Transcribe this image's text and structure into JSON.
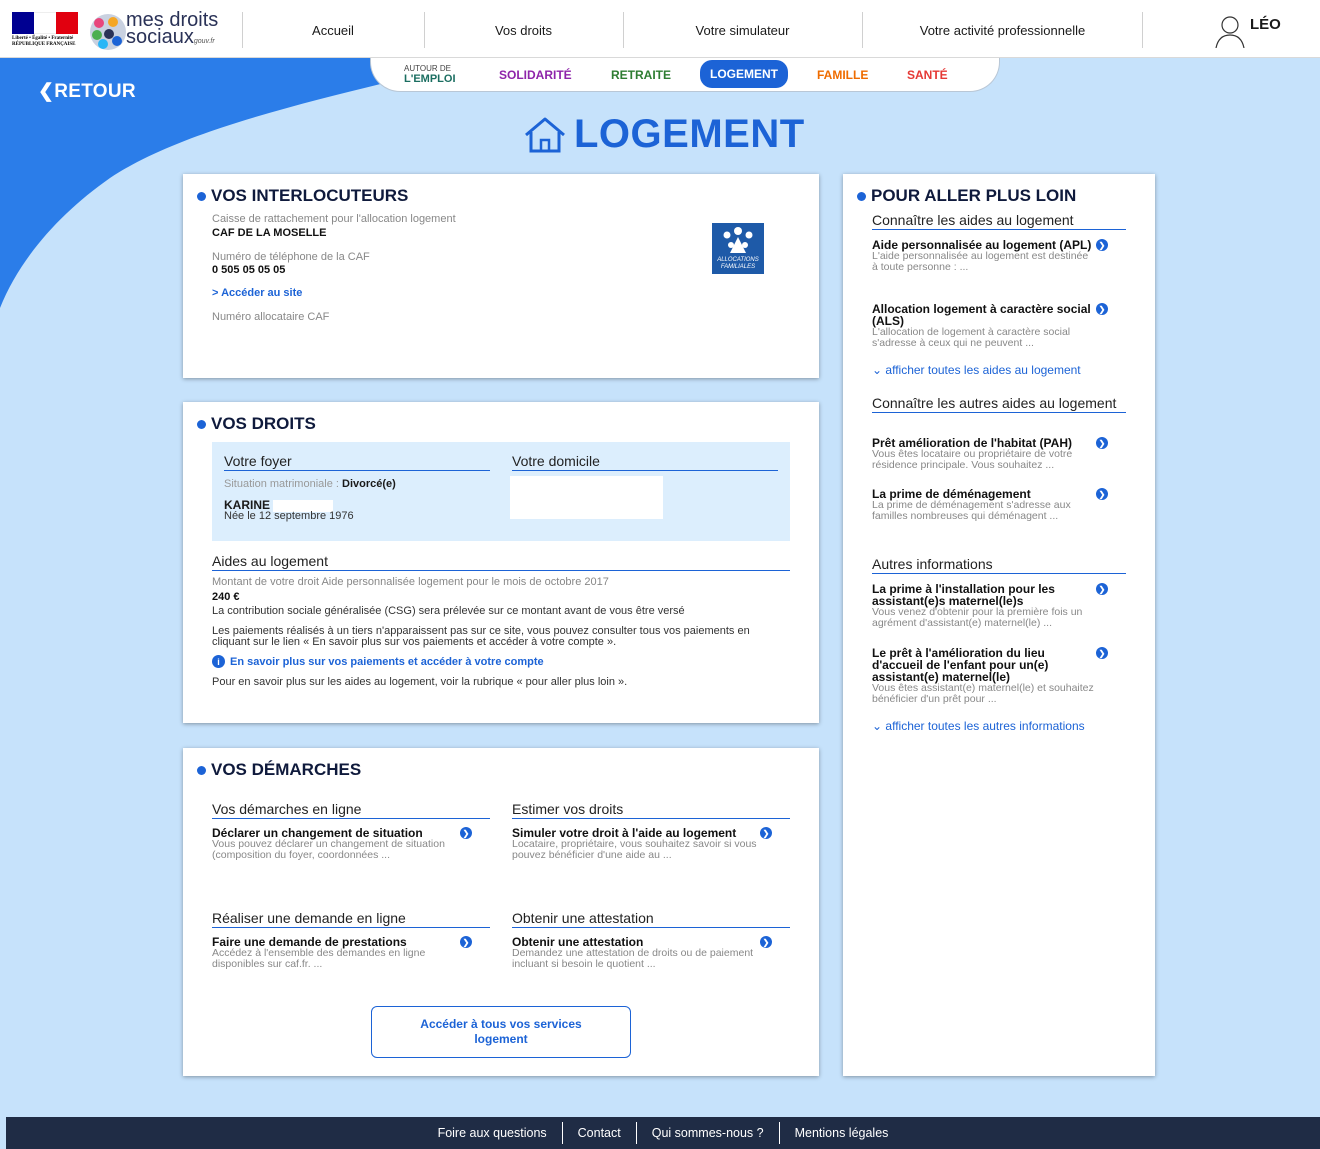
{
  "header": {
    "rf_text": "Liberté • Égalité • Fraternité\nRÉPUBLIQUE FRANÇAISE",
    "logo_line1": "mes droits",
    "logo_line2": "sociaux",
    "logo_domain": "gouv.fr",
    "nav": [
      "Accueil",
      "Vos droits",
      "Votre simulateur",
      "Votre activité professionnelle"
    ],
    "user_name": "LÉO"
  },
  "back_label": "RETOUR",
  "tabs": {
    "emploi_small": "AUTOUR DE",
    "emploi": "L'EMPLOI",
    "solidarite": "SOLIDARITÉ",
    "retraite": "RETRAITE",
    "logement": "LOGEMENT",
    "famille": "FAMILLE",
    "sante": "SANTÉ"
  },
  "colors": {
    "accent": "#1c63d6",
    "solidarite": "#8e24aa",
    "retraite": "#2e7d32",
    "famille": "#ef6c00",
    "sante": "#e53935",
    "emploi": "#1b6e61"
  },
  "page_title": "LOGEMENT",
  "interlocuteurs": {
    "title": "VOS INTERLOCUTEURS",
    "caisse_label": "Caisse de rattachement pour l'allocation logement",
    "caisse_value": "CAF DE LA MOSELLE",
    "phone_label": "Numéro de téléphone de la CAF",
    "phone_value": "0 505 05 05 05",
    "site_link": "> Accéder au site",
    "allocataire_label": "Numéro allocataire CAF",
    "caf_logo_text": "ALLOCATIONS FAMILIALES"
  },
  "droits": {
    "title": "VOS DROITS",
    "foyer_head": "Votre foyer",
    "domicile_head": "Votre domicile",
    "situation_label": "Situation matrimoniale :",
    "situation_value": "Divorcé(e)",
    "person_name": "KARINE",
    "person_birth": "Née le 12 septembre 1976",
    "aides_head": "Aides au logement",
    "montant_label": "Montant de votre droit Aide personnalisée logement pour le mois de octobre 2017",
    "montant_value": "240 €",
    "csg_text": "La contribution sociale généralisée (CSG) sera prélevée sur ce montant avant de vous être versé",
    "paiements_text": "Les paiements réalisés à un tiers n'apparaissent pas sur ce site, vous pouvez consulter tous vos paiements en cliquant sur le lien « En savoir plus sur vos paiements et accéder à votre compte ».",
    "paiements_link": "En savoir plus sur vos paiements et accéder à votre compte",
    "plus_loin_text": "Pour en savoir plus sur les aides au logement, voir la rubrique « pour aller plus loin »."
  },
  "demarches": {
    "title": "VOS DÉMARCHES",
    "sections": [
      {
        "head": "Vos démarches en ligne",
        "item_title": "Déclarer un changement de situation",
        "item_desc": "Vous pouvez déclarer un changement de situation (composition du foyer, coordonnées ..."
      },
      {
        "head": "Estimer vos droits",
        "item_title": "Simuler votre droit à l'aide au logement",
        "item_desc": "Locataire, propriétaire, vous souhaitez savoir si vous pouvez bénéficier d'une aide au ..."
      },
      {
        "head": "Réaliser une demande en ligne",
        "item_title": "Faire une demande de prestations",
        "item_desc": "Accédez à l'ensemble des demandes en ligne disponibles sur caf.fr. ..."
      },
      {
        "head": "Obtenir une attestation",
        "item_title": "Obtenir une attestation",
        "item_desc": "Demandez une attestation de droits ou de paiement incluant si besoin le quotient ..."
      }
    ],
    "services_button": "Accéder à tous vos services logement"
  },
  "plus_loin": {
    "title": "POUR ALLER PLUS LOIN",
    "sections": [
      {
        "head": "Connaître les aides au logement",
        "items": [
          {
            "title": "Aide personnalisée au logement (APL)",
            "desc": "L'aide personnalisée au logement est destinée à toute personne : ..."
          },
          {
            "title": "Allocation logement à caractère social (ALS)",
            "desc": "L'allocation de logement à caractère social s'adresse à ceux qui ne peuvent ..."
          }
        ],
        "more": "afficher toutes les aides au logement"
      },
      {
        "head": "Connaître les autres aides au logement",
        "items": [
          {
            "title": "Prêt amélioration de l'habitat (PAH)",
            "desc": "Vous êtes locataire ou propriétaire de votre résidence principale. Vous souhaitez ..."
          },
          {
            "title": "La prime de déménagement",
            "desc": "La prime de déménagement s'adresse aux familles nombreuses qui déménagent ..."
          }
        ]
      },
      {
        "head": "Autres informations",
        "items": [
          {
            "title": "La prime à l'installation pour les assistant(e)s maternel(le)s",
            "desc": "Vous venez d'obtenir pour la première fois un agrément d'assistant(e) maternel(le) ..."
          },
          {
            "title": "Le prêt à l'amélioration du lieu d'accueil de l'enfant pour un(e) assistant(e) maternel(le)",
            "desc": "Vous êtes assistant(e) maternel(le) et souhaitez bénéficier d'un prêt pour ..."
          }
        ],
        "more": "afficher toutes les autres informations"
      }
    ]
  },
  "footer": [
    "Foire aux questions",
    "Contact",
    "Qui sommes-nous ?",
    "Mentions légales"
  ]
}
